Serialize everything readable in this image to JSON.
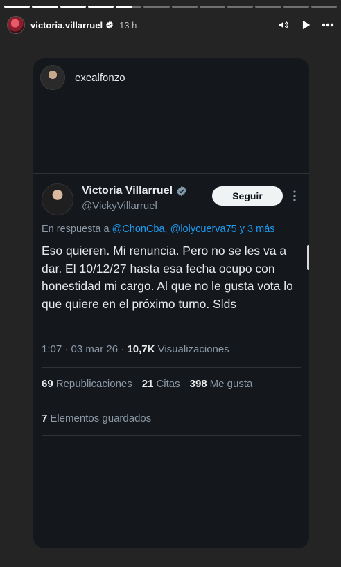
{
  "story": {
    "progress_segments": 12,
    "progress_current_index": 4,
    "progress_current_fraction": 0.65,
    "username": "victoria.villarruel",
    "time_ago": "13 h",
    "icons": [
      "verified-badge-icon",
      "volume-icon",
      "play-icon",
      "more-options-icon"
    ]
  },
  "shared_card": {
    "sharer_username": "exealfonzo"
  },
  "tweet": {
    "author_name": "Victoria Villarruel",
    "author_handle": "@VickyVillarruel",
    "follow_label": "Seguir",
    "reply_prefix": "En respuesta a",
    "reply_mentions": "@ChonCba, @lolycuerva75 y 3 más",
    "text": "Eso quieren. Mi renuncia. Pero no se les va a dar. El 10/12/27 hasta esa fecha ocupo con honestidad mi cargo. Al que no le gusta vota lo que quiere en el próximo turno. Slds",
    "time": "1:07 · 03 mar 26 ·",
    "views_count": "10,7K",
    "views_label": "Visualizaciones",
    "reposts_count": "69",
    "reposts_label": "Republicaciones",
    "quotes_count": "21",
    "quotes_label": "Citas",
    "likes_count": "398",
    "likes_label": "Me gusta",
    "bookmarks_count": "7",
    "bookmarks_label": "Elementos guardados"
  },
  "colors": {
    "background": "#242424",
    "card": "#14181d",
    "link": "#1d9bf0",
    "muted": "#8b98a5",
    "verified": "#829aab"
  }
}
